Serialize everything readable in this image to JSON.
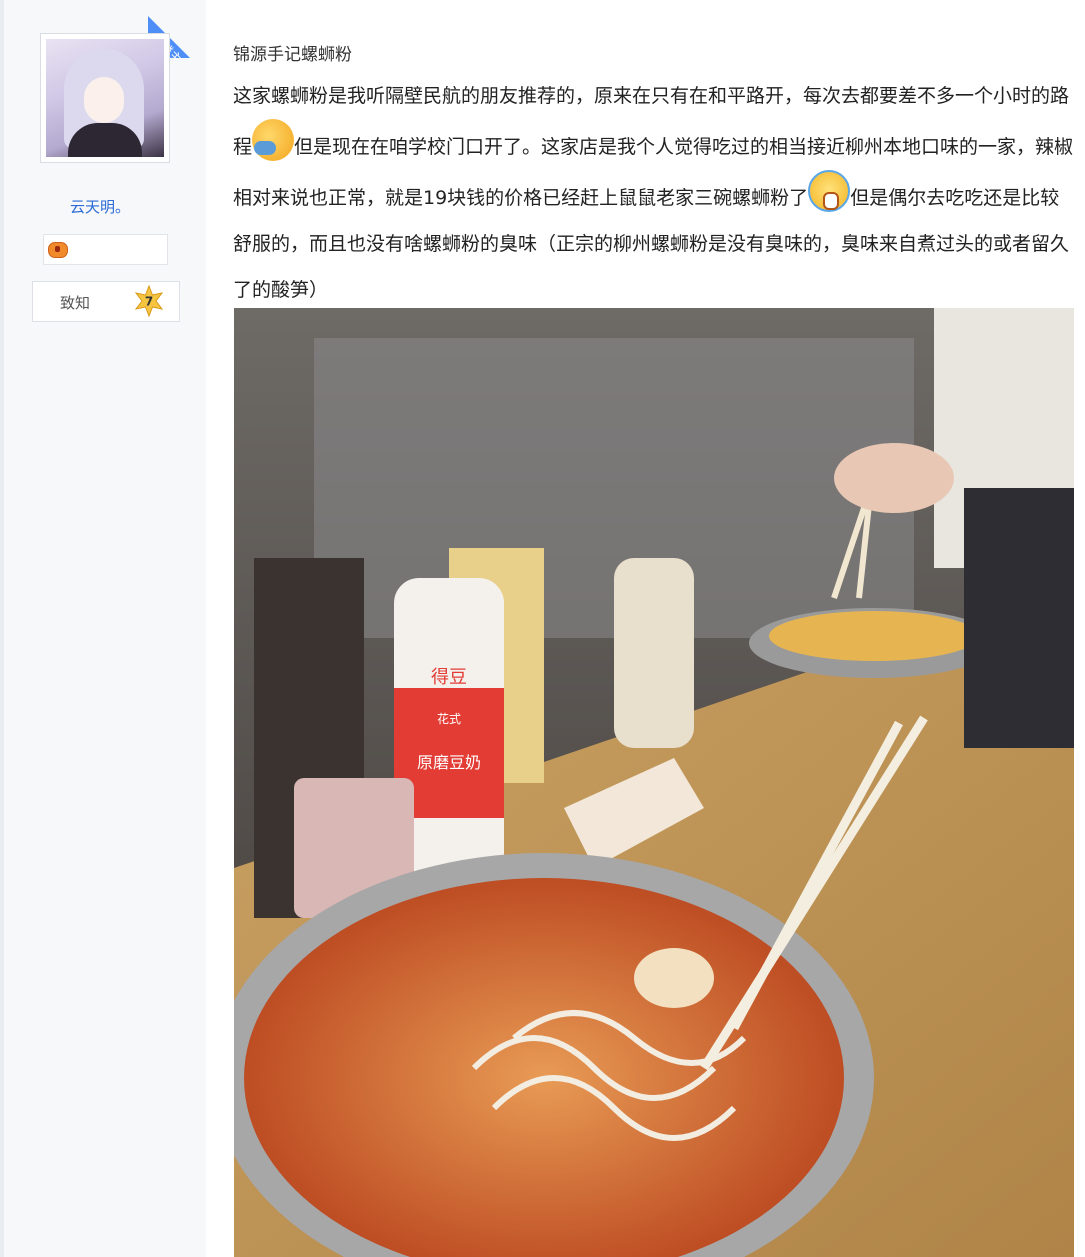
{
  "author": {
    "badge_label": "楼主",
    "username": "云天明。",
    "rank_label": "致知",
    "rank_level": "7",
    "avatar_icon": "anime-girl-avatar",
    "level_icon": "gamepad-icon"
  },
  "post": {
    "title": "锦源手记螺蛳粉",
    "paragraph_part1": "这家螺蛳粉是我听隔壁民航的朋友推荐的，原来在只有在和平路开，每次去都要差不多一个小时的路程",
    "paragraph_part2": "但是现在在咱学校门口开了。这家店是我个人觉得吃过的相当接近柳州本地口味的一家，辣椒相对来说也正常，就是19块钱的价格已经赶上鼠鼠老家三碗螺蛳粉了",
    "paragraph_part3": "但是偶尔去吃吃还是比较舒服的，而且也没有啥螺蛳粉的臭味（正宗的柳州螺蛳粉是没有臭味的，臭味来自煮过头的或者留久了的酸笋）",
    "emoji_1": "sick-emoji",
    "emoji_2": "crying-emoji",
    "photo_subject": "bowl-of-luosifen-noodles-photo",
    "bottle_brand": "得豆",
    "bottle_sub": "花式",
    "bottle_label": "原磨豆奶"
  },
  "colors": {
    "accent": "#2a6bd5",
    "badge": "#4e8ef7",
    "sidebar_bg": "#f7f8fa"
  }
}
